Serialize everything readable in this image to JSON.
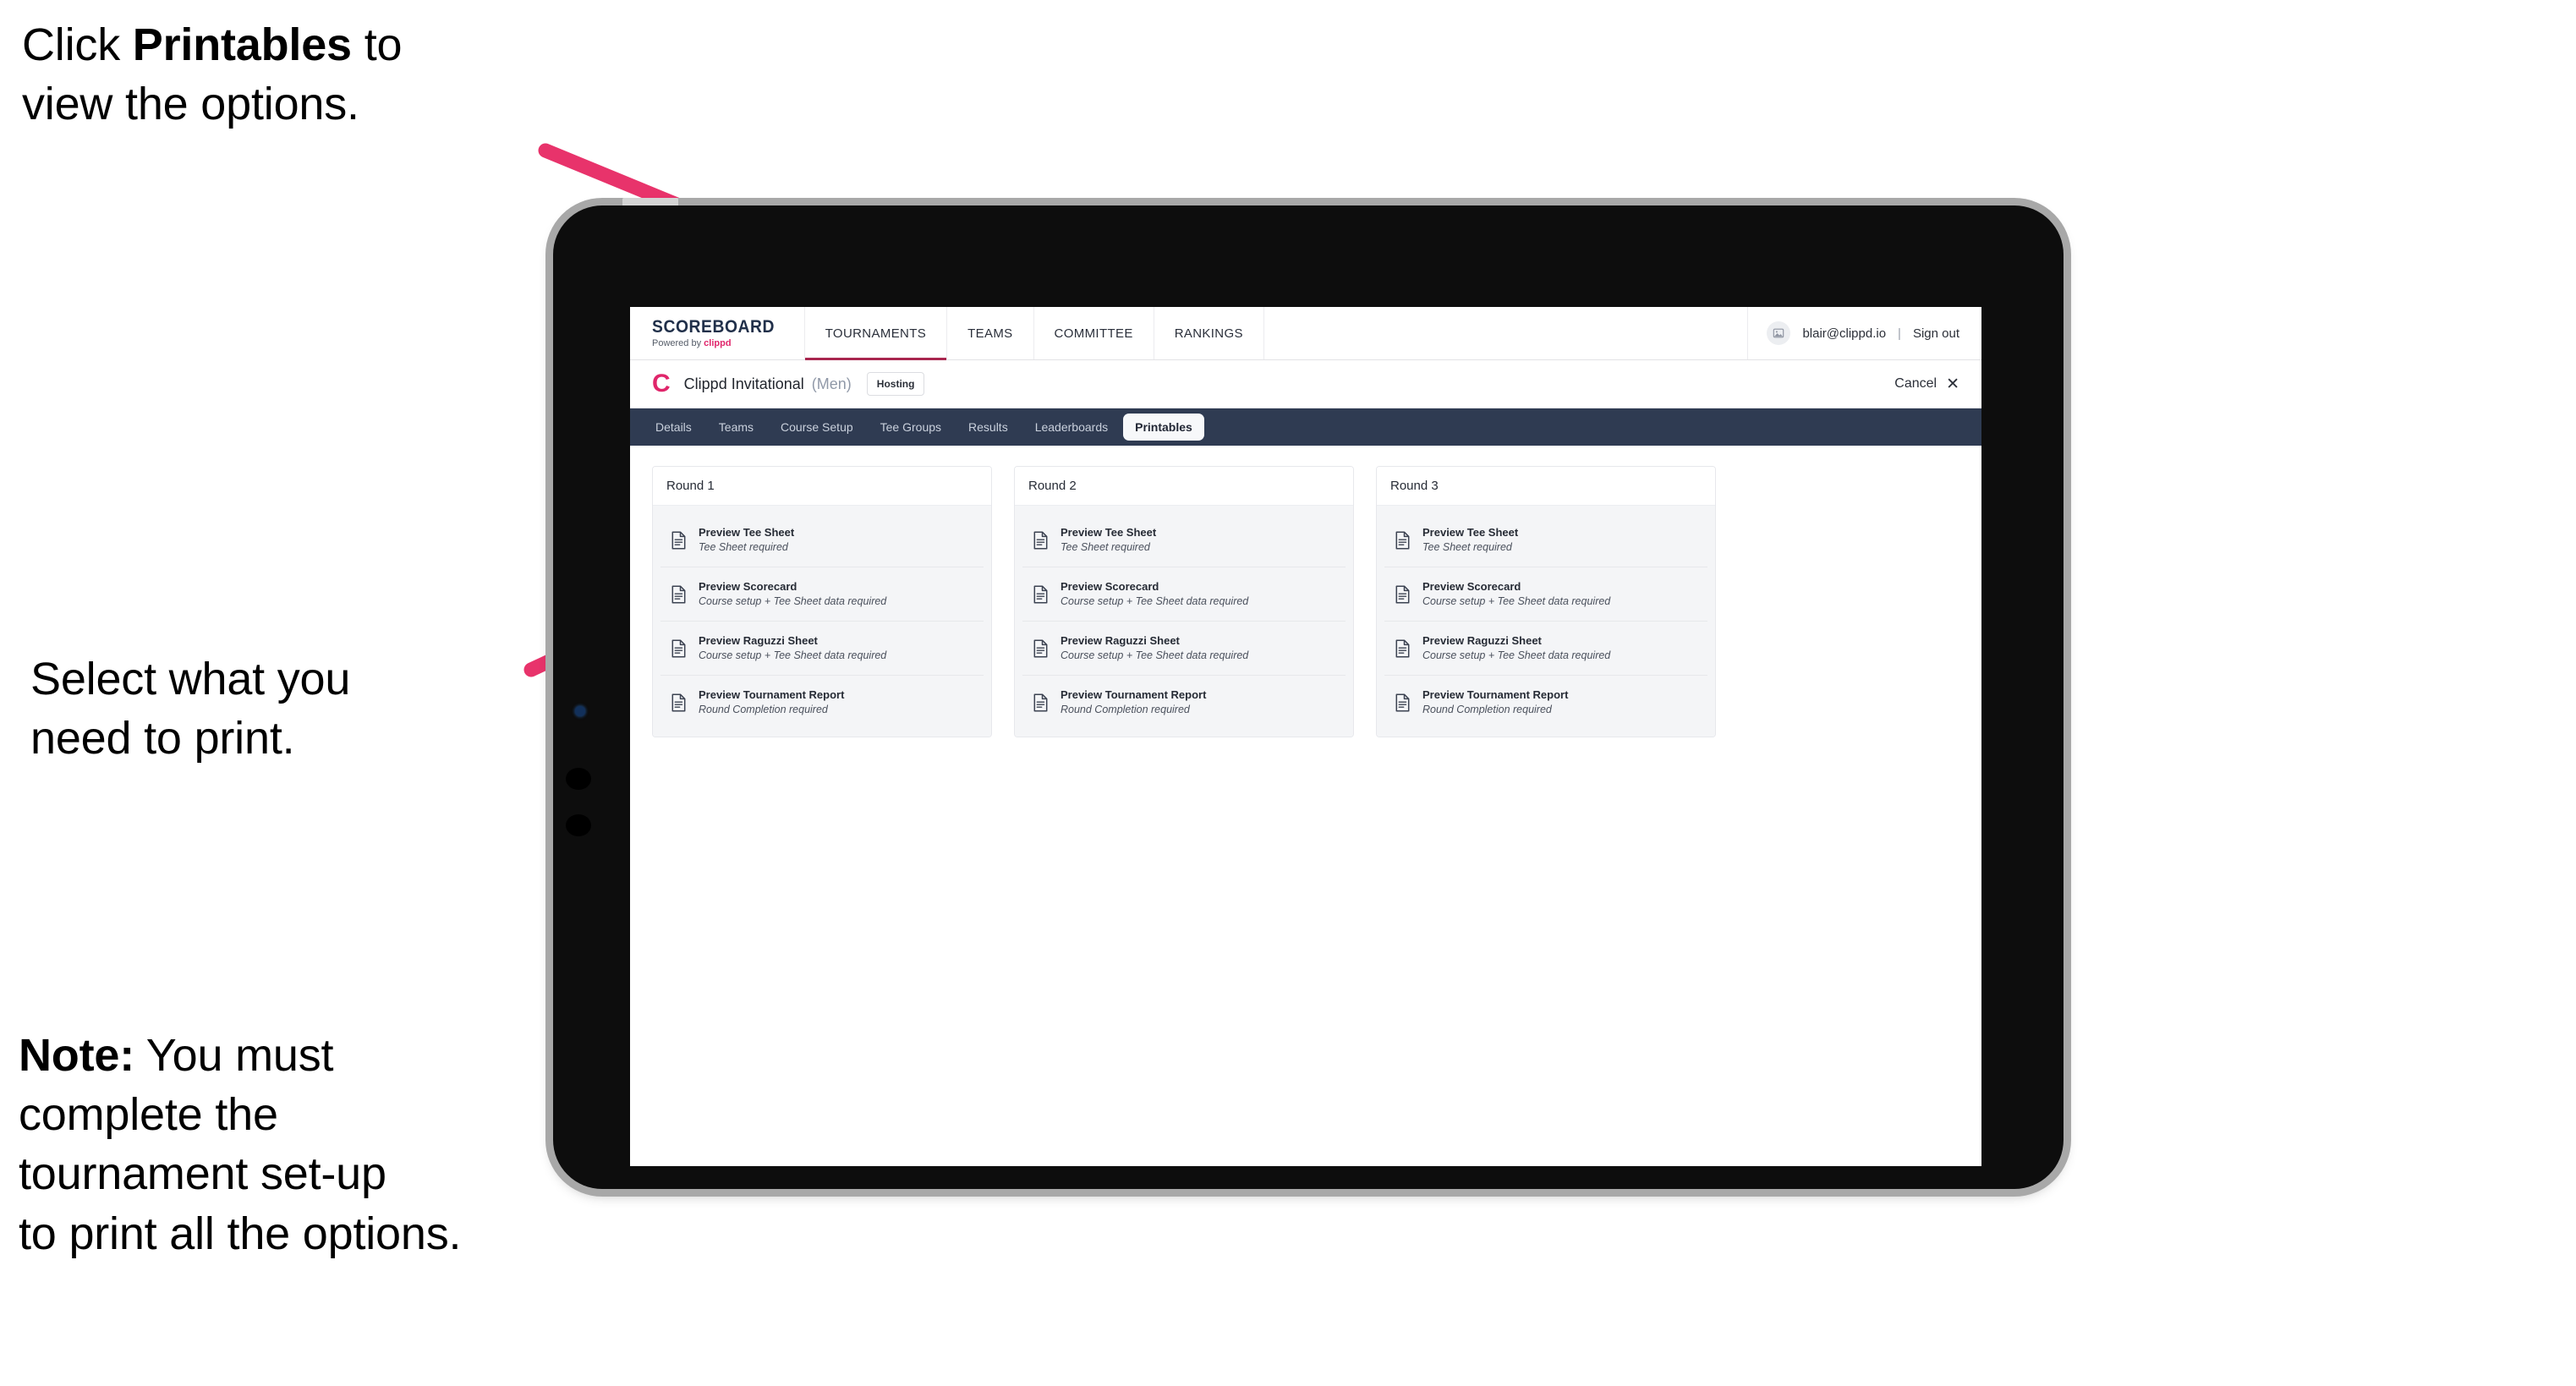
{
  "annotations": {
    "click_printables": "Click <b>Printables</b> to\nview the options.",
    "select_print": "Select what you\n need to print.",
    "note": "<b>Note:</b> You must\ncomplete the\ntournament set-up\nto print all the options."
  },
  "app": {
    "brand": {
      "title": "SCOREBOARD",
      "powered_by_prefix": "Powered by ",
      "powered_by_name": "clippd"
    },
    "main_nav": [
      {
        "label": "TOURNAMENTS",
        "active": true
      },
      {
        "label": "TEAMS",
        "active": false
      },
      {
        "label": "COMMITTEE",
        "active": false
      },
      {
        "label": "RANKINGS",
        "active": false
      }
    ],
    "user": {
      "avatar_icon": "user-image-icon",
      "email": "blair@clippd.io",
      "separator": "|",
      "sign_out": "Sign out"
    },
    "tournament_bar": {
      "logo_letter": "C",
      "name": "Clippd Invitational",
      "gender": "(Men)",
      "badge": "Hosting",
      "cancel_label": "Cancel",
      "cancel_icon": "close-x-icon"
    },
    "tabs": [
      {
        "label": "Details",
        "active": false
      },
      {
        "label": "Teams",
        "active": false
      },
      {
        "label": "Course Setup",
        "active": false
      },
      {
        "label": "Tee Groups",
        "active": false
      },
      {
        "label": "Results",
        "active": false
      },
      {
        "label": "Leaderboards",
        "active": false
      },
      {
        "label": "Printables",
        "active": true
      }
    ],
    "rounds": [
      {
        "title": "Round 1",
        "items": [
          {
            "title": "Preview Tee Sheet",
            "sub": "Tee Sheet required"
          },
          {
            "title": "Preview Scorecard",
            "sub": "Course setup + Tee Sheet data required"
          },
          {
            "title": "Preview Raguzzi Sheet",
            "sub": "Course setup + Tee Sheet data required"
          },
          {
            "title": "Preview Tournament Report",
            "sub": "Round Completion required"
          }
        ]
      },
      {
        "title": "Round 2",
        "items": [
          {
            "title": "Preview Tee Sheet",
            "sub": "Tee Sheet required"
          },
          {
            "title": "Preview Scorecard",
            "sub": "Course setup + Tee Sheet data required"
          },
          {
            "title": "Preview Raguzzi Sheet",
            "sub": "Course setup + Tee Sheet data required"
          },
          {
            "title": "Preview Tournament Report",
            "sub": "Round Completion required"
          }
        ]
      },
      {
        "title": "Round 3",
        "items": [
          {
            "title": "Preview Tee Sheet",
            "sub": "Tee Sheet required"
          },
          {
            "title": "Preview Scorecard",
            "sub": "Course setup + Tee Sheet data required"
          },
          {
            "title": "Preview Raguzzi Sheet",
            "sub": "Course setup + Tee Sheet data required"
          },
          {
            "title": "Preview Tournament Report",
            "sub": "Round Completion required"
          }
        ]
      }
    ]
  },
  "colors": {
    "accent_pink": "#e8336b",
    "brand_pink": "#e0266b",
    "tabbar_dark": "#2f3b52",
    "nav_underline": "#a8264f",
    "tablet_body": "#0d0d0d",
    "tablet_edge": "#a8a8a8"
  }
}
